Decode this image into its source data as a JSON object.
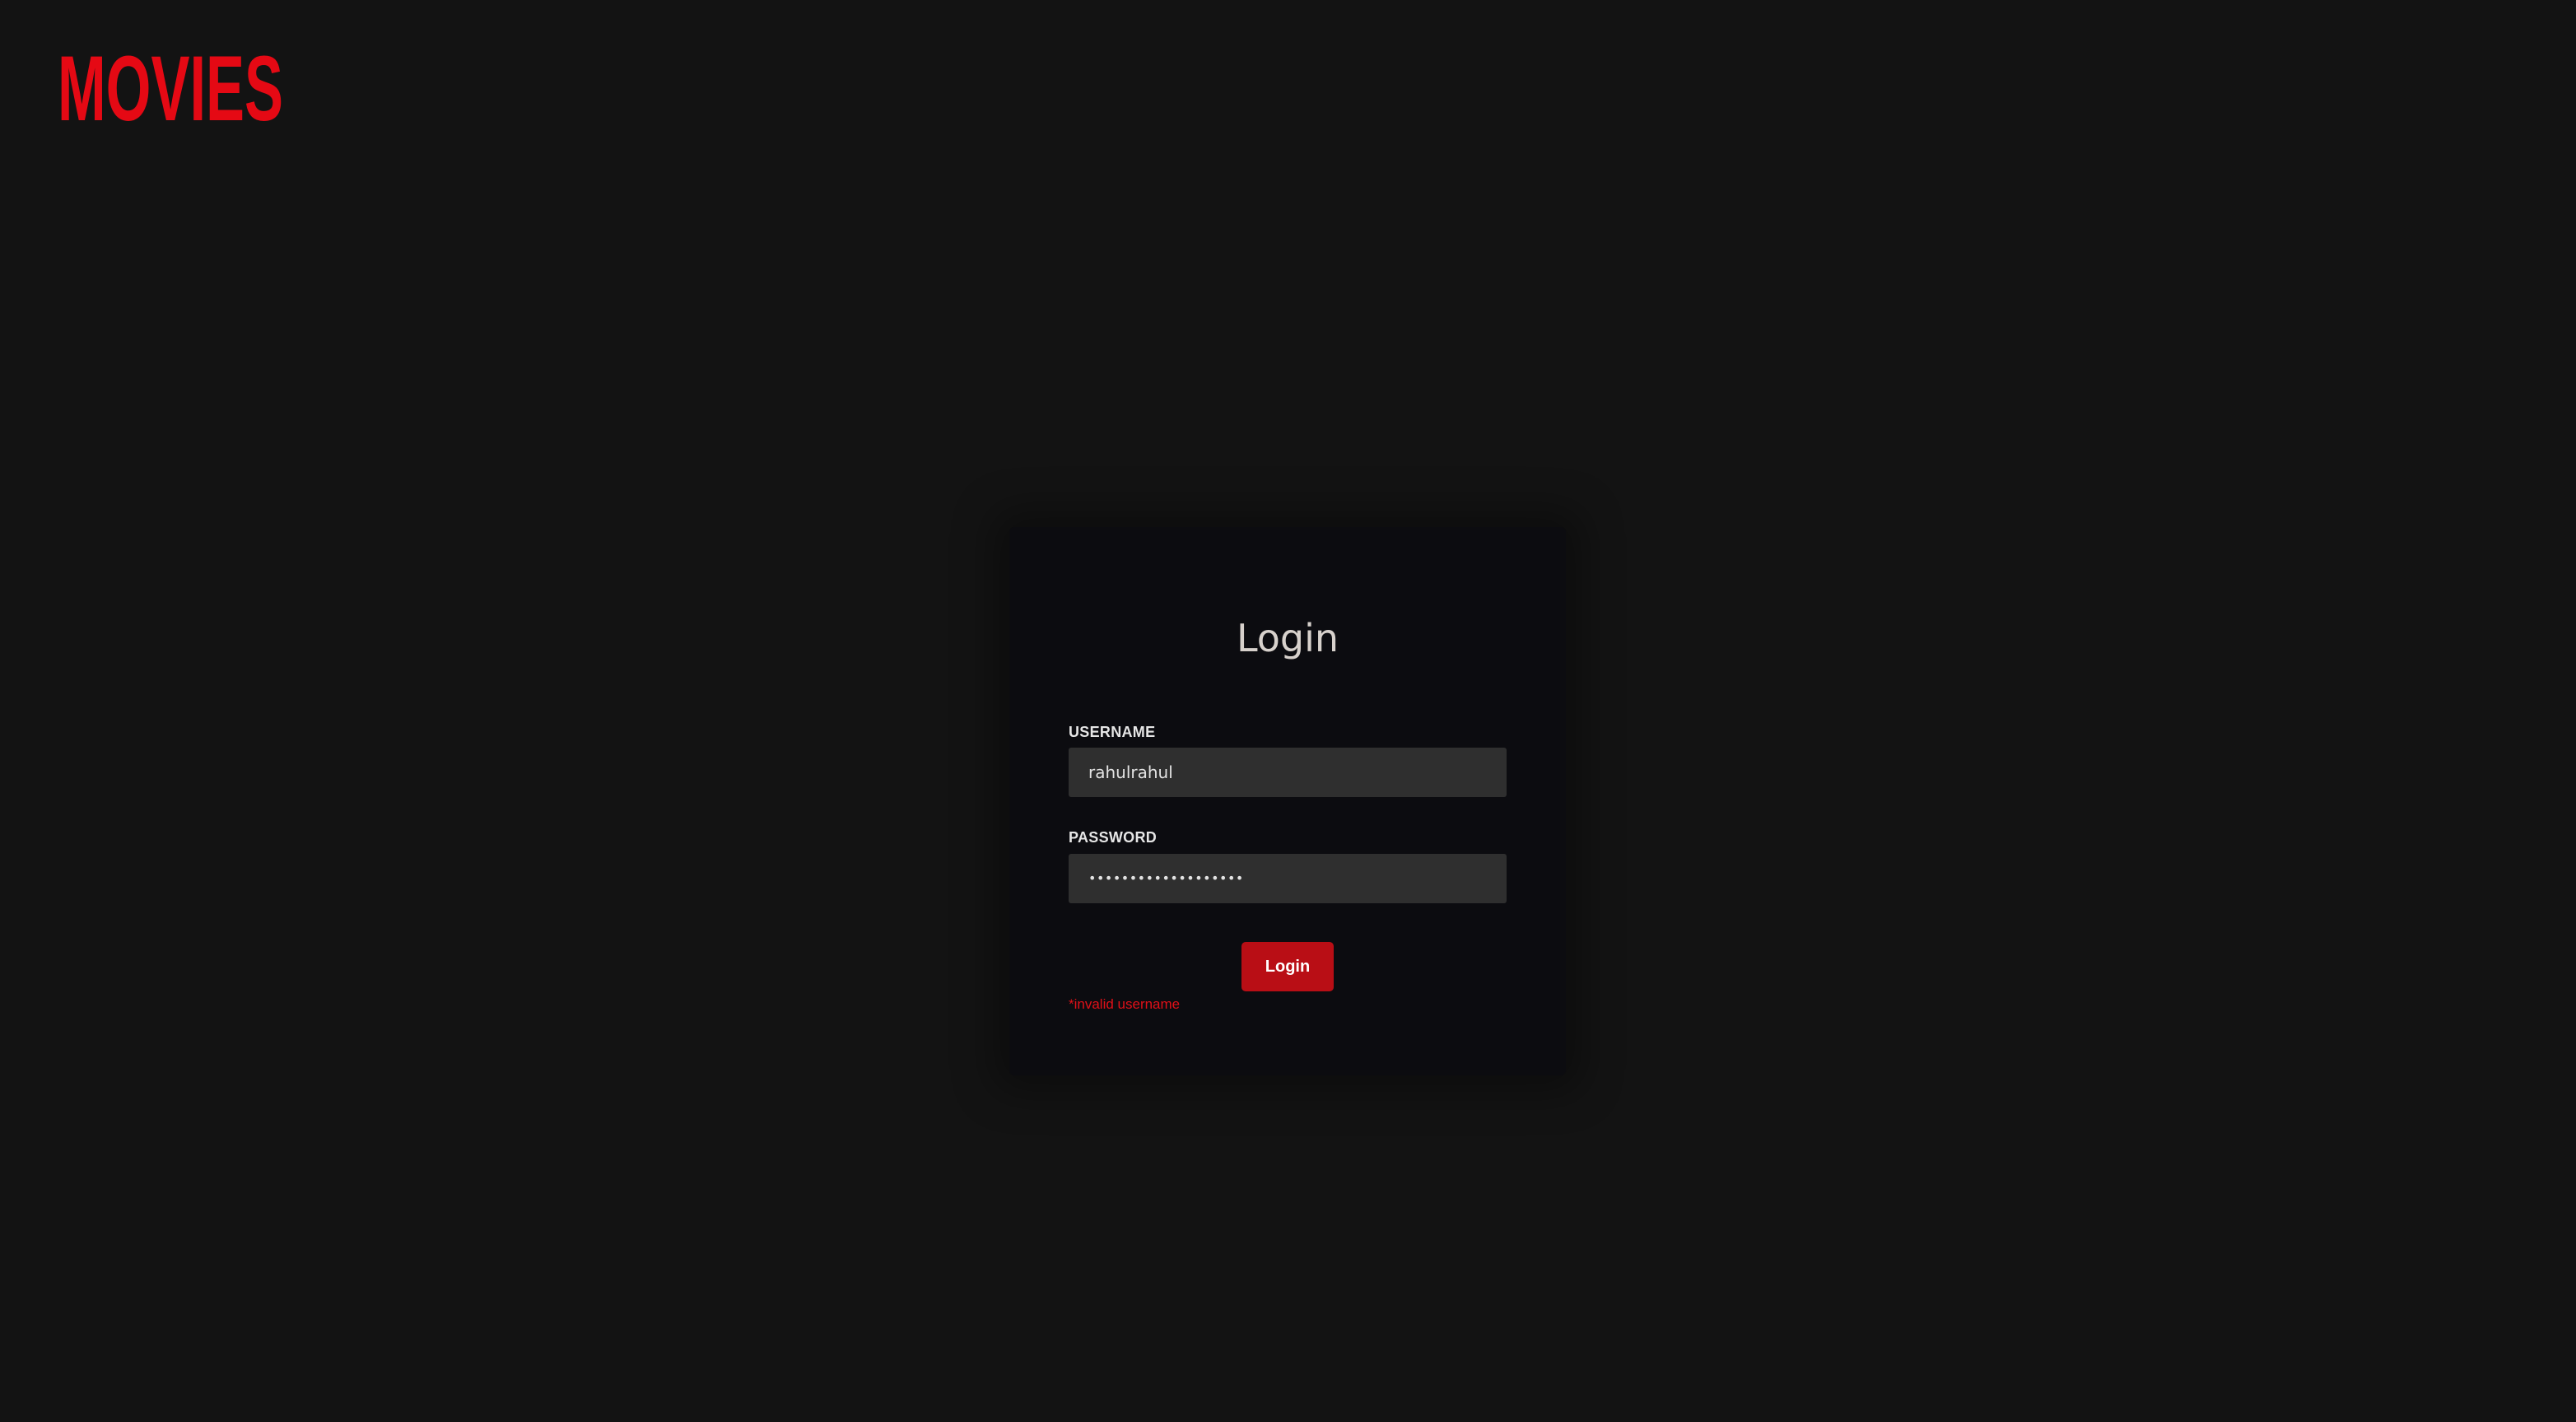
{
  "header": {
    "logo_text": "MOVIES",
    "logo_color": "#e50914"
  },
  "login": {
    "title": "Login",
    "username_label": "USERNAME",
    "username_value": "rahulrahul",
    "password_label": "PASSWORD",
    "password_value": "•••••••••••••••••••",
    "submit_label": "Login",
    "error_message": "*invalid username"
  },
  "colors": {
    "page_background": "#131313",
    "card_background": "#0c0c10",
    "input_background": "#2f2f2f",
    "button_background": "#b90e15",
    "error_text": "#e01018"
  }
}
